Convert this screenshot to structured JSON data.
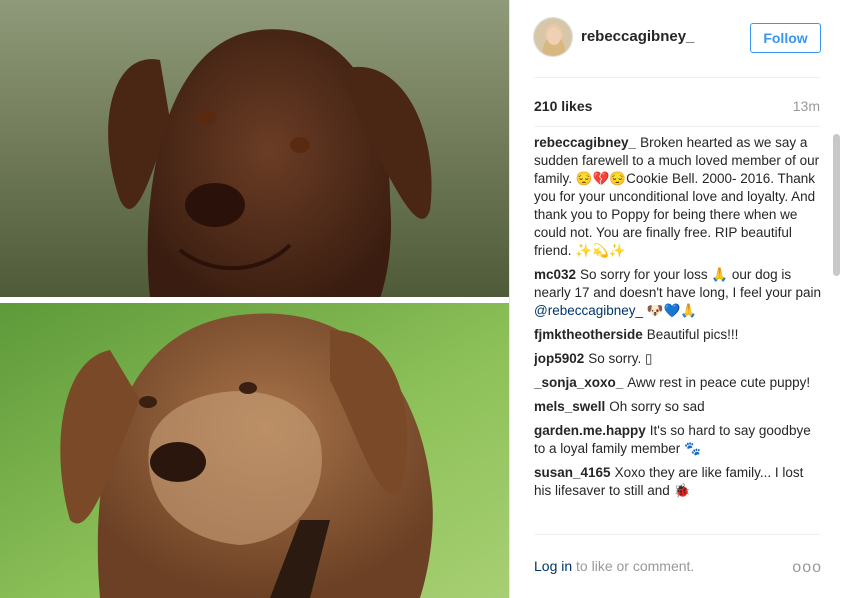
{
  "header": {
    "username": "rebeccagibney_",
    "follow_label": "Follow"
  },
  "stats": {
    "likes": "210 likes",
    "time": "13m"
  },
  "comments": [
    {
      "user": "rebeccagibney_",
      "text": "Broken hearted as we say a sudden farewell to a much loved member of our family. 😔💔😔Cookie Bell. 2000- 2016. Thank you for your unconditional love and loyalty. And thank you to Poppy for being there when we could not. You are finally free. RIP beautiful friend. ✨💫✨"
    },
    {
      "user": "mc032",
      "text": "So sorry for your loss 🙏 our dog is nearly 17 and doesn't have long, I feel your pain",
      "mention": "@rebeccagibney_",
      "tail": " 🐶💙🙏"
    },
    {
      "user": "fjmktheotherside",
      "text": "Beautiful pics!!!"
    },
    {
      "user": "jop5902",
      "text": "So sorry. ▯"
    },
    {
      "user": "_sonja_xoxo_",
      "text": "Aww rest in peace cute puppy!"
    },
    {
      "user": "mels_swell",
      "text": "Oh sorry so sad"
    },
    {
      "user": "garden.me.happy",
      "text": "It's so hard to say goodbye to a loyal family member 🐾"
    },
    {
      "user": "susan_4165",
      "text": "Xoxo they are like family... I lost his lifesaver to still and 🐞"
    }
  ],
  "footer": {
    "login": "Log in",
    "rest": " to like or comment.",
    "more": "ooo"
  },
  "colors": {
    "link": "#3897f0",
    "dark_link": "#003569",
    "text": "#262626",
    "muted": "#999999"
  }
}
